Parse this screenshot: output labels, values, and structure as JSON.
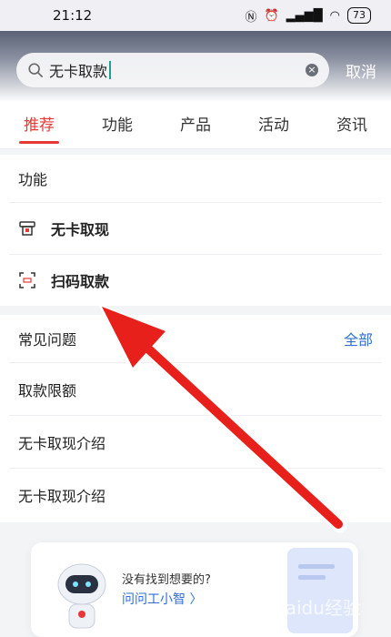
{
  "status_bar": {
    "time": "21:12",
    "battery": "73"
  },
  "search": {
    "query": "无卡取款",
    "cancel_label": "取消"
  },
  "tabs": [
    {
      "label": "推荐",
      "active": true
    },
    {
      "label": "功能"
    },
    {
      "label": "产品"
    },
    {
      "label": "活动"
    },
    {
      "label": "资讯"
    }
  ],
  "functions": {
    "title": "功能",
    "items": [
      {
        "label": "无卡取现",
        "icon": "atm-icon"
      },
      {
        "label": "扫码取款",
        "icon": "scan-code-icon"
      }
    ]
  },
  "faq": {
    "title": "常见问题",
    "more_label": "全部",
    "items": [
      {
        "label": "取款限额"
      },
      {
        "label": "无卡取现介绍"
      },
      {
        "label": "无卡取现介绍"
      }
    ]
  },
  "assistant": {
    "question": "没有找到想要的?",
    "link_label": "问问工小智 〉"
  },
  "watermark": "Baidu经验",
  "colors": {
    "accent": "#e53935",
    "link": "#2f6fd6",
    "arrow": "#e8201c"
  }
}
